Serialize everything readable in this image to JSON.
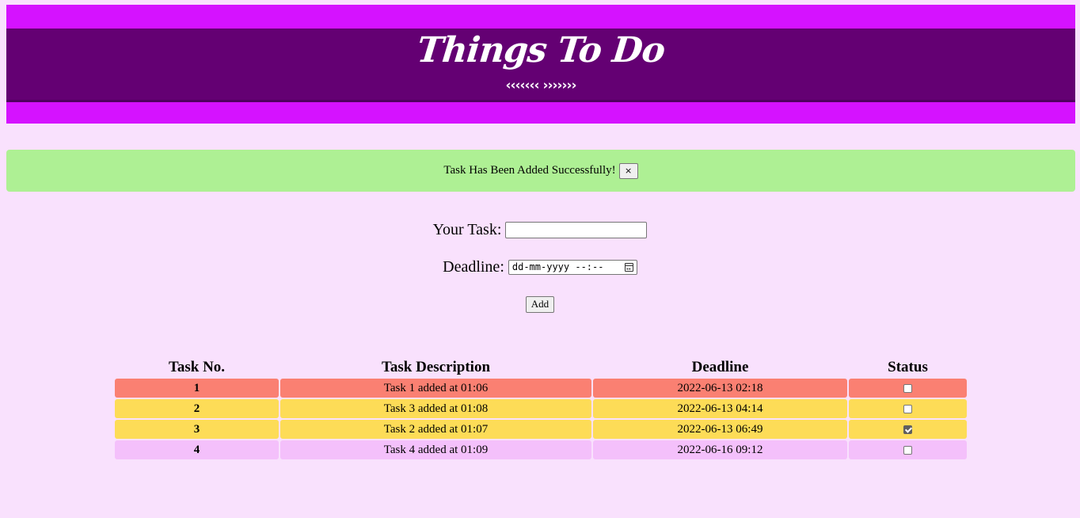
{
  "header": {
    "title": "Things To Do",
    "arrows": "‹‹‹‹‹‹‹ ›››››››"
  },
  "alert": {
    "message": "Task Has Been Added Successfully!",
    "close_label": "×"
  },
  "form": {
    "task_label": "Your Task:",
    "task_value": "",
    "deadline_label": "Deadline:",
    "deadline_placeholder": "dd-mm-yyyy --:--",
    "add_label": "Add"
  },
  "table": {
    "headers": [
      "Task No.",
      "Task Description",
      "Deadline",
      "Status"
    ],
    "rows": [
      {
        "no": "1",
        "description": "Task 1 added at 01:06",
        "deadline": "2022-06-13 02:18",
        "done": false,
        "color": "#fa8072"
      },
      {
        "no": "2",
        "description": "Task 3 added at 01:08",
        "deadline": "2022-06-13 04:14",
        "done": false,
        "color": "#fddc57"
      },
      {
        "no": "3",
        "description": "Task 2 added at 01:07",
        "deadline": "2022-06-13 06:49",
        "done": true,
        "color": "#fddc57"
      },
      {
        "no": "4",
        "description": "Task 4 added at 01:09",
        "deadline": "2022-06-16 09:12",
        "done": false,
        "color": "#f4c0fb"
      }
    ]
  },
  "colors": {
    "page_background": "#f9e1fd",
    "banner_outer": "#d512ff",
    "banner_inner": "#640073",
    "alert_background": "#aef094"
  }
}
